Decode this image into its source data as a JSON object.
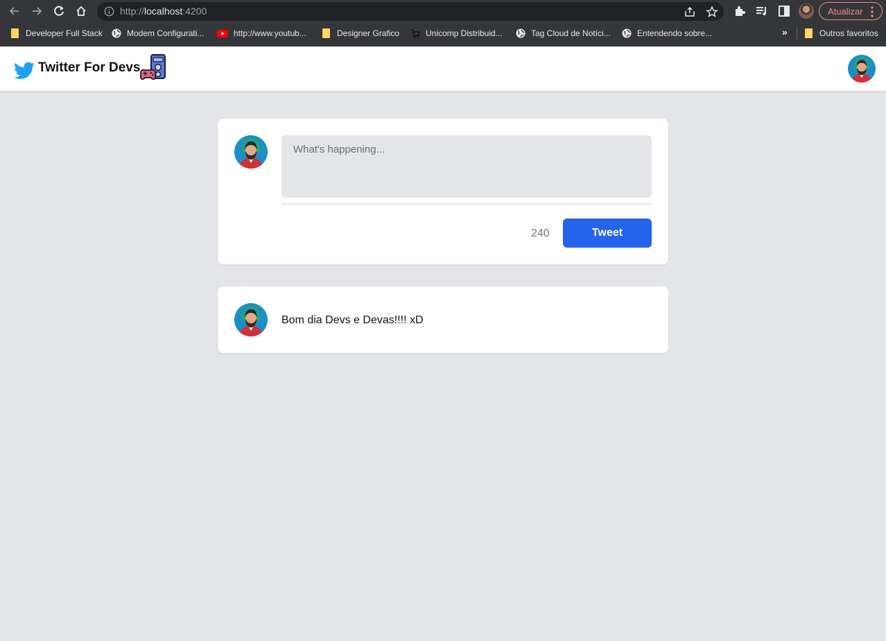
{
  "browser": {
    "url_scheme": "http://",
    "url_host": "localhost",
    "url_port": ":4200",
    "update_label": "Atualizar",
    "bookmarks": [
      {
        "label": "Developer Full Stack",
        "icon": "folder-icon"
      },
      {
        "label": "Modem Configurati...",
        "icon": "globe-icon"
      },
      {
        "label": "http://www.youtub...",
        "icon": "youtube-icon"
      },
      {
        "label": "Designer Grafico",
        "icon": "folder-icon"
      },
      {
        "label": "Unicomp Distribuid...",
        "icon": "cart-icon"
      },
      {
        "label": "Tag Cloud de Notíci...",
        "icon": "globe-icon"
      },
      {
        "label": "Entendendo sobre...",
        "icon": "globe-icon"
      }
    ],
    "more_label": "»",
    "other_bookmarks": "Outros favoritos"
  },
  "header": {
    "title": "Twitter For Devs",
    "logo_icon": "twitter-bird-icon"
  },
  "composer": {
    "placeholder": "What's happening...",
    "value": "",
    "char_count": "240",
    "tweet_label": "Tweet"
  },
  "tweets": [
    {
      "text": "Bom dia Devs e Devas!!!! xD"
    }
  ],
  "colors": {
    "accent": "#2563eb",
    "page_background": "#e4e5e9",
    "bird": "#1da1f2"
  }
}
